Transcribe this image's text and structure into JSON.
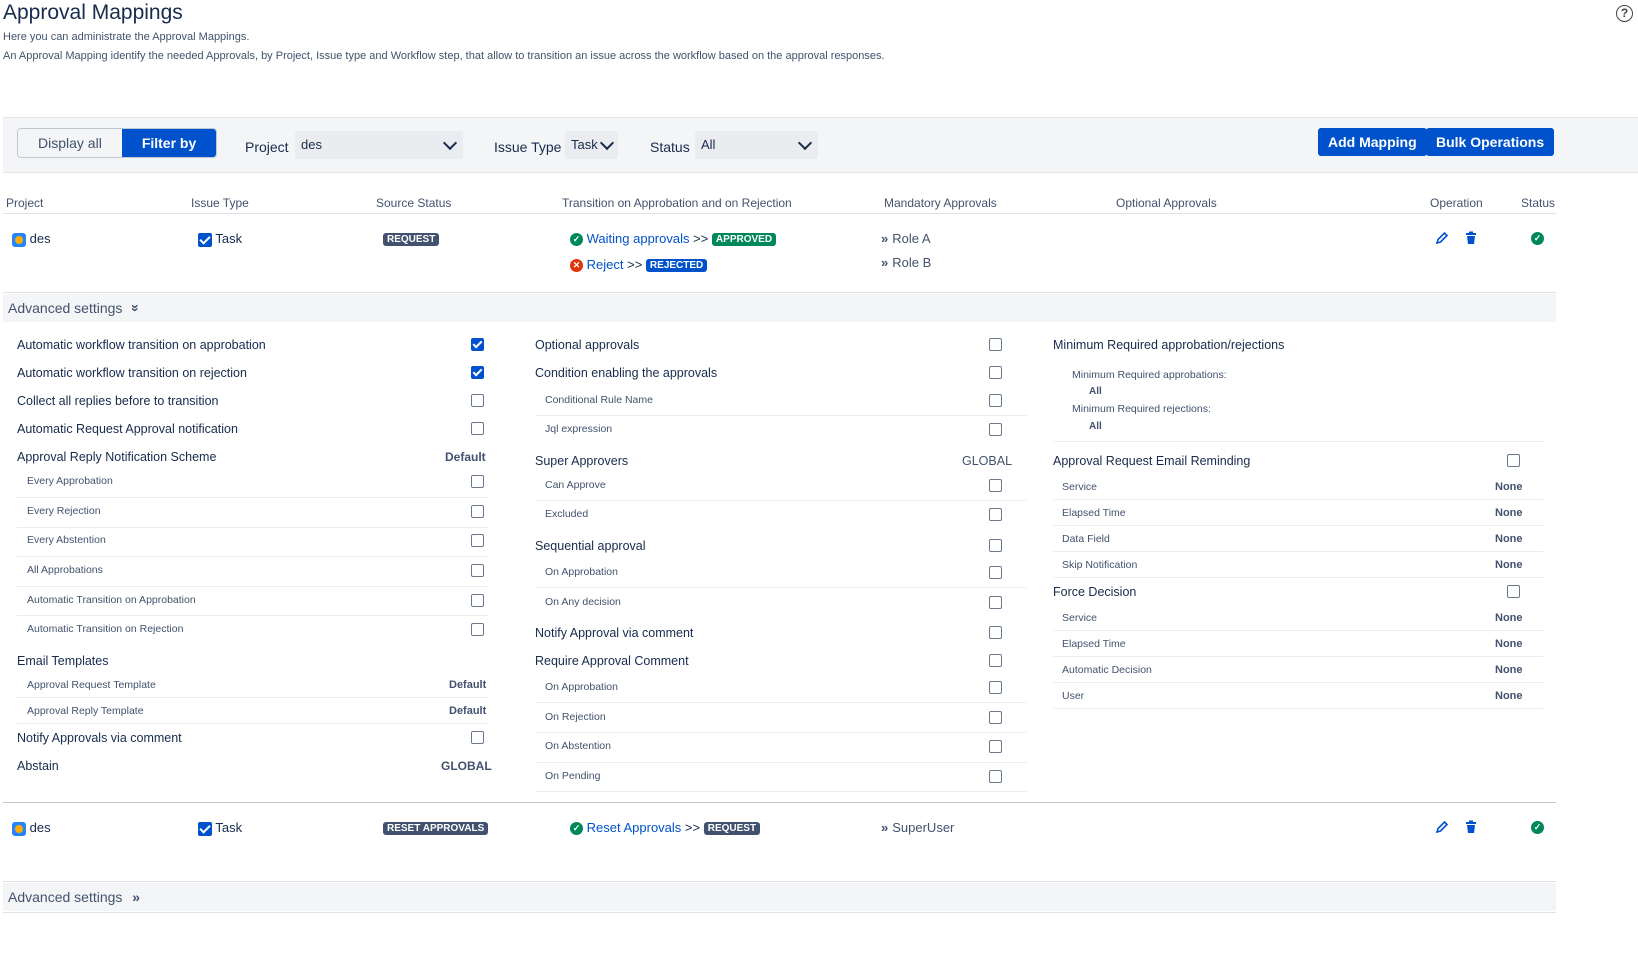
{
  "page": {
    "title": "Approval Mappings",
    "help": "?",
    "desc1": "Here you can administrate the Approval Mappings.",
    "desc2": "An Approval Mapping identify the needed Approvals, by Project, Issue type and Workflow step, that allow to transition an issue across the workflow based on the approval responses."
  },
  "toolbar": {
    "display_all": "Display all",
    "filter_by": "Filter by",
    "project_label": "Project",
    "project_value": "des",
    "issue_type_label": "Issue Type",
    "issue_type_value": "Task",
    "status_label": "Status",
    "status_value": "All",
    "add_mapping": "Add Mapping",
    "bulk_operations": "Bulk Operations"
  },
  "table": {
    "headers": [
      "Project",
      "Issue Type",
      "Source Status",
      "Transition on Approbation and on Rejection",
      "Mandatory Approvals",
      "Optional Approvals",
      "Operation",
      "Status"
    ]
  },
  "row1": {
    "project": "des",
    "issue_type": "Task",
    "source_status": "REQUEST",
    "t1_name": "Waiting approvals",
    "t1_arrow": ">>",
    "t1_target": "APPROVED",
    "t2_name": "Reject",
    "t2_arrow": ">>",
    "t2_target": "REJECTED",
    "mandatory": [
      "Role A",
      "Role B"
    ]
  },
  "row2": {
    "project": "des",
    "issue_type": "Task",
    "source_status": "RESET APPROVALS",
    "t1_name": "Reset Approvals",
    "t1_arrow": ">>",
    "t1_target": "REQUEST",
    "mandatory": [
      "SuperUser"
    ]
  },
  "advanced": {
    "label": "Advanced settings"
  },
  "col1": {
    "auto_approb": "Automatic workflow transition on approbation",
    "auto_rej": "Automatic workflow transition on rejection",
    "collect": "Collect all replies before to transition",
    "auto_notif": "Automatic Request Approval notification",
    "reply_scheme": "Approval Reply Notification Scheme",
    "reply_scheme_val": "Default",
    "every_approb": "Every Approbation",
    "every_rej": "Every Rejection",
    "every_abst": "Every Abstention",
    "all_approb": "All Approbations",
    "auto_tr_approb": "Automatic Transition on Approbation",
    "auto_tr_rej": "Automatic Transition on Rejection",
    "email_templates": "Email Templates",
    "req_template": "Approval Request Template",
    "req_template_val": "Default",
    "reply_template": "Approval Reply Template",
    "reply_template_val": "Default",
    "notify_comment": "Notify Approvals via comment",
    "abstain": "Abstain",
    "abstain_val": "GLOBAL"
  },
  "col2": {
    "optional": "Optional approvals",
    "condition": "Condition enabling the approvals",
    "cond_rule": "Conditional Rule Name",
    "jql": "Jql expression",
    "super": "Super Approvers",
    "super_val": "GLOBAL",
    "can_approve": "Can Approve",
    "excluded": "Excluded",
    "sequential": "Sequential approval",
    "on_approb": "On Approbation",
    "on_any": "On Any decision",
    "notify_comment": "Notify Approval via comment",
    "require_comment": "Require Approval Comment",
    "rc_approb": "On Approbation",
    "rc_rej": "On Rejection",
    "rc_abst": "On Abstention",
    "rc_pend": "On Pending"
  },
  "col3": {
    "min_req": "Minimum Required approbation/rejections",
    "min_approb": "Minimum Required approbations:",
    "min_approb_val": "All",
    "min_rej": "Minimum Required rejections:",
    "min_rej_val": "All",
    "email_remind": "Approval Request Email Reminding",
    "service": "Service",
    "service_val": "None",
    "elapsed": "Elapsed Time",
    "elapsed_val": "None",
    "data_field": "Data Field",
    "data_field_val": "None",
    "skip": "Skip Notification",
    "skip_val": "None",
    "force": "Force Decision",
    "f_service": "Service",
    "f_service_val": "None",
    "f_elapsed": "Elapsed Time",
    "f_elapsed_val": "None",
    "f_auto": "Automatic Decision",
    "f_auto_val": "None",
    "f_user": "User",
    "f_user_val": "None"
  },
  "colors": {
    "primary": "#0052cc",
    "success": "#00875a",
    "danger": "#de350b"
  }
}
